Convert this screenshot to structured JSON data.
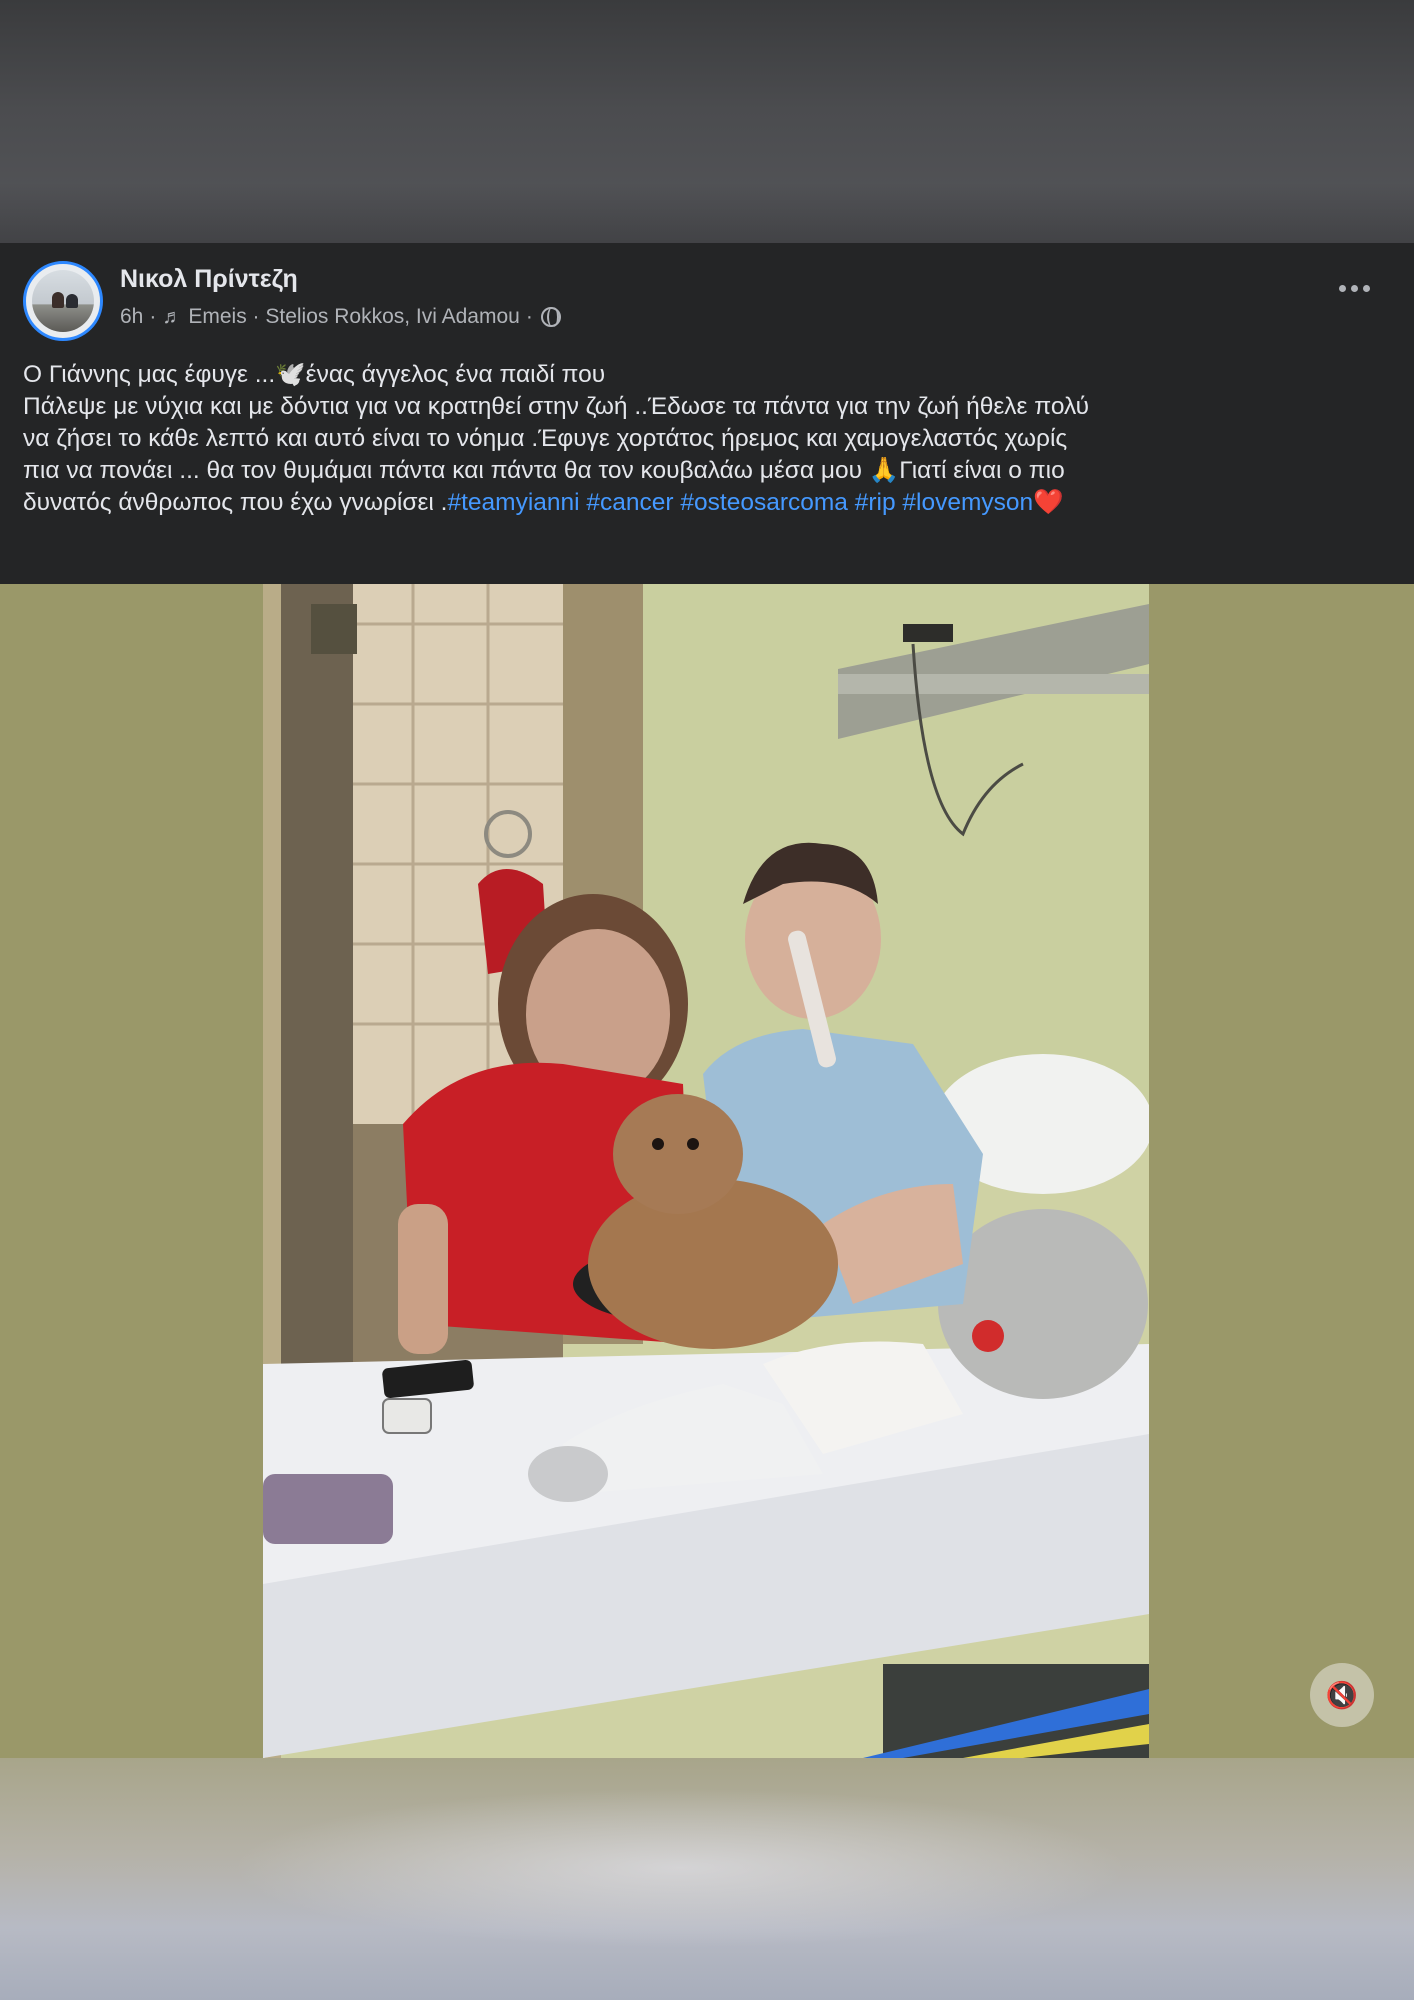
{
  "post": {
    "author": "Νικολ Πρίντεζη",
    "time": "6h",
    "music_icon": "♬",
    "music": "Emeis · Stelios Rokkos, Ivi Adamou",
    "privacy_icon": "globe-icon",
    "more_icon": "more-options-icon",
    "text_lines": [
      "Ο Γιάννης μας έφυγε ...🕊️ένας άγγελος ένα παιδί που",
      "Πάλεψε με νύχια και με δόντια για να κρατηθεί στην ζωή ..Έδωσε τα πάντα για την ζωή ήθελε πολύ",
      "να ζήσει το κάθε λεπτό και αυτό είναι το νόημα .Έφυγε χορτάτος ήρεμος και χαμογελαστός χωρίς",
      "πια να πονάει ... θα τον θυμάμαι πάντα και πάντα θα τον κουβαλάω μέσα μου 🙏Γιατί είναι ο πιο",
      "δυνατός άνθρωπος που έχω γνωρίσει ."
    ],
    "hashtags": [
      "#teamyianni",
      "#cancer",
      "#osteosarcoma",
      "#rip",
      "#lovemyson"
    ],
    "heart": "❤️"
  },
  "video": {
    "mute_icon": "speaker-muted-icon",
    "mute_symbol": "🔇"
  },
  "colors": {
    "card_bg": "#242526",
    "text": "#e4e6eb",
    "secondary_text": "#b0b3b8",
    "link": "#4599ff",
    "avatar_ring": "#2d88ff",
    "page_bg": "#9a9869"
  }
}
